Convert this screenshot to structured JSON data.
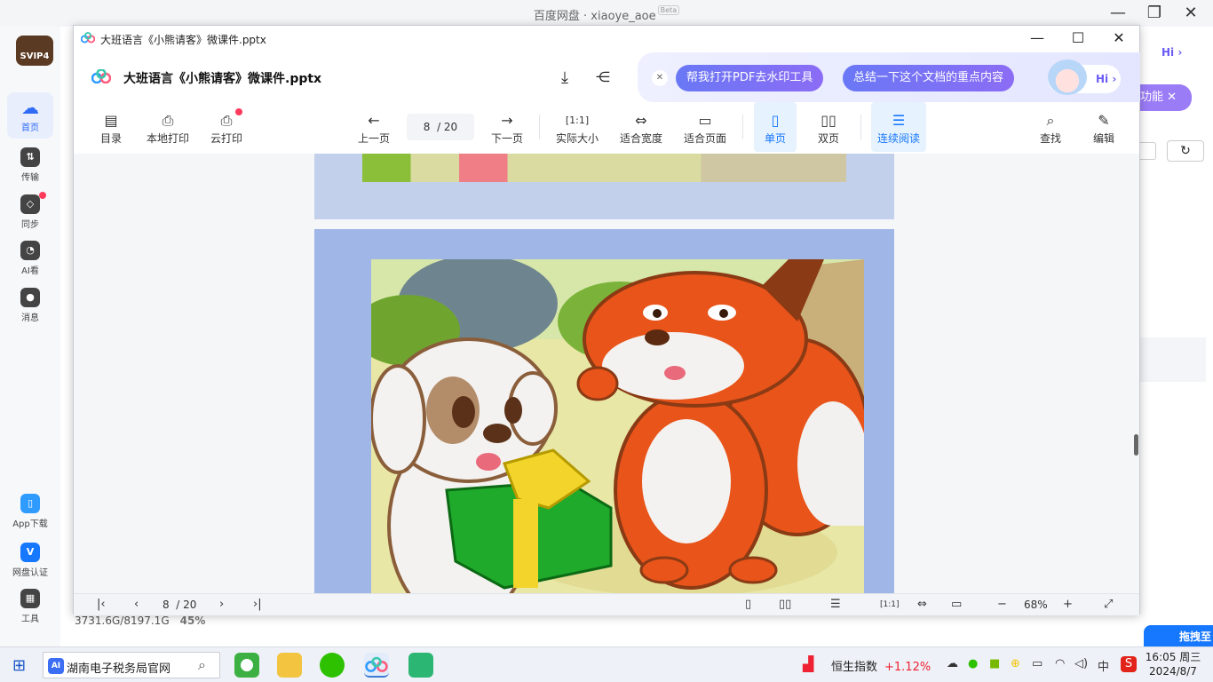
{
  "background_app": {
    "title_main": "百度网盘 · xiaoye_aoe",
    "title_badge": "Beta",
    "logo_text": "SVIP4",
    "sidebar": [
      {
        "label": "首页",
        "icon": "cloud-icon"
      },
      {
        "label": "传输",
        "icon": "transfer-icon"
      },
      {
        "label": "同步",
        "icon": "sync-icon"
      },
      {
        "label": "AI看",
        "icon": "ai-look-icon"
      },
      {
        "label": "消息",
        "icon": "message-icon"
      }
    ],
    "sidebar_bottom": [
      {
        "label": "App下载",
        "icon": "phone-icon"
      },
      {
        "label": "网盘认证",
        "icon": "verify-icon"
      },
      {
        "label": "工具",
        "icon": "tools-icon"
      }
    ],
    "storage": "3731.6G/8197.1G",
    "storage_pct": "45%",
    "hi_label": "Hi",
    "feature_label": "功能",
    "drag_label": "拖拽至"
  },
  "viewer": {
    "window_title": "大班语言《小熊请客》微课件.pptx",
    "doc_title": "大班语言《小熊请客》微课件.pptx",
    "ai_chips": [
      "帮我打开PDF去水印工具",
      "总结一下这个文档的重点内容"
    ],
    "ai_hi": "Hi",
    "toolbar": {
      "toc": "目录",
      "local_print": "本地打印",
      "cloud_print": "云打印",
      "prev_page": "上一页",
      "page_current": "8",
      "page_total": "/ 20",
      "next_page": "下一页",
      "actual_size": "实际大小",
      "fit_width": "适合宽度",
      "fit_page": "适合页面",
      "single_page": "单页",
      "double_page": "双页",
      "continuous": "连续阅读",
      "find": "查找",
      "edit": "编辑"
    },
    "bottom": {
      "page_current": "8",
      "page_total": "/ 20",
      "zoom": "68%"
    }
  },
  "taskbar": {
    "search_text": "湖南电子税务局官网",
    "search_ai": "AI",
    "stock_name": "恒生指数",
    "stock_change": "+1.12%",
    "ime": "中",
    "time": "16:05 周三",
    "date": "2024/8/7"
  }
}
